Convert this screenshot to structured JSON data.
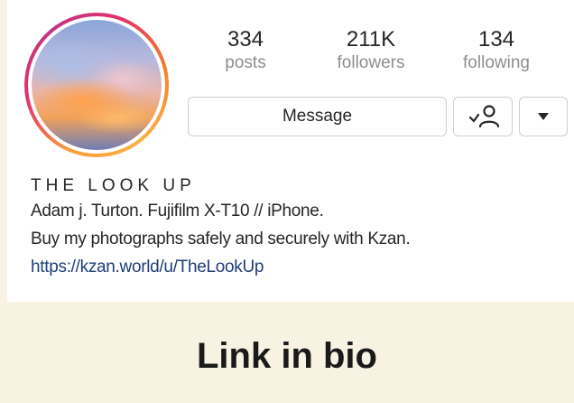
{
  "profile": {
    "stats": [
      {
        "value": "334",
        "label": "posts"
      },
      {
        "value": "211K",
        "label": "followers"
      },
      {
        "value": "134",
        "label": "following"
      }
    ],
    "message_label": "Message",
    "bio": {
      "name": "THE LOOK UP",
      "line1": "Adam j. Turton. Fujifilm X-T10 // iPhone.",
      "line2": "Buy my photographs safely and securely with Kzan.",
      "link": "https://kzan.world/u/TheLookUp"
    }
  },
  "icons": {
    "follow_status": "following-check-person-icon",
    "more": "caret-down-icon"
  },
  "caption": "Link in bio",
  "colors": {
    "background": "#f8f2e3",
    "link": "#1f3d7a",
    "ring_start": "#f9a13a",
    "ring_end": "#c13584"
  }
}
